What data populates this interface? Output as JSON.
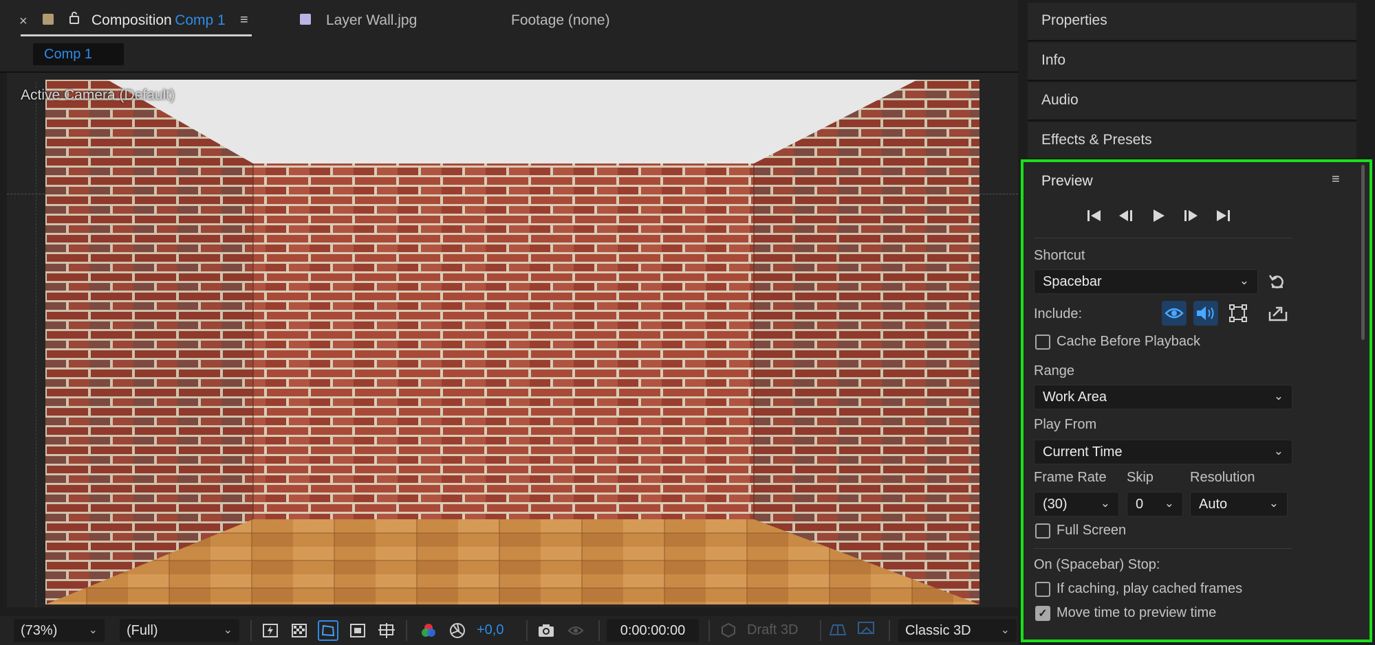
{
  "tabs": {
    "composition_label": "Composition",
    "composition_name": "Comp 1",
    "layer_tab": "Layer Wall.jpg",
    "footage_tab": "Footage (none)"
  },
  "viewer": {
    "comp_chip": "Comp 1",
    "camera_label": "Active Camera (Default)"
  },
  "toolbar": {
    "zoom": "(73%)",
    "resolution": "(Full)",
    "exposure": "+0,0",
    "timecode": "0:00:00:00",
    "draft3d": "Draft 3D",
    "renderer": "Classic 3D"
  },
  "right_panels": {
    "properties": "Properties",
    "info": "Info",
    "audio": "Audio",
    "effects": "Effects & Presets"
  },
  "preview": {
    "title": "Preview",
    "shortcut_label": "Shortcut",
    "shortcut_value": "Spacebar",
    "include_label": "Include:",
    "cache_before_playback": "Cache Before Playback",
    "range_label": "Range",
    "range_value": "Work Area",
    "play_from_label": "Play From",
    "play_from_value": "Current Time",
    "frame_rate_label": "Frame Rate",
    "frame_rate_value": "(30)",
    "skip_label": "Skip",
    "skip_value": "0",
    "resolution_label": "Resolution",
    "resolution_value": "Auto",
    "full_screen": "Full Screen",
    "stop_label": "On (Spacebar) Stop:",
    "if_caching": "If caching, play cached frames",
    "move_time": "Move time to preview time",
    "cache_before_playback_checked": false,
    "full_screen_checked": false,
    "if_caching_checked": false,
    "move_time_checked": true
  },
  "colors": {
    "accent": "#2d8ceb",
    "highlight_border": "#19e019",
    "swatch_comp": "#b19b70",
    "swatch_layer": "#b9b4e6"
  }
}
